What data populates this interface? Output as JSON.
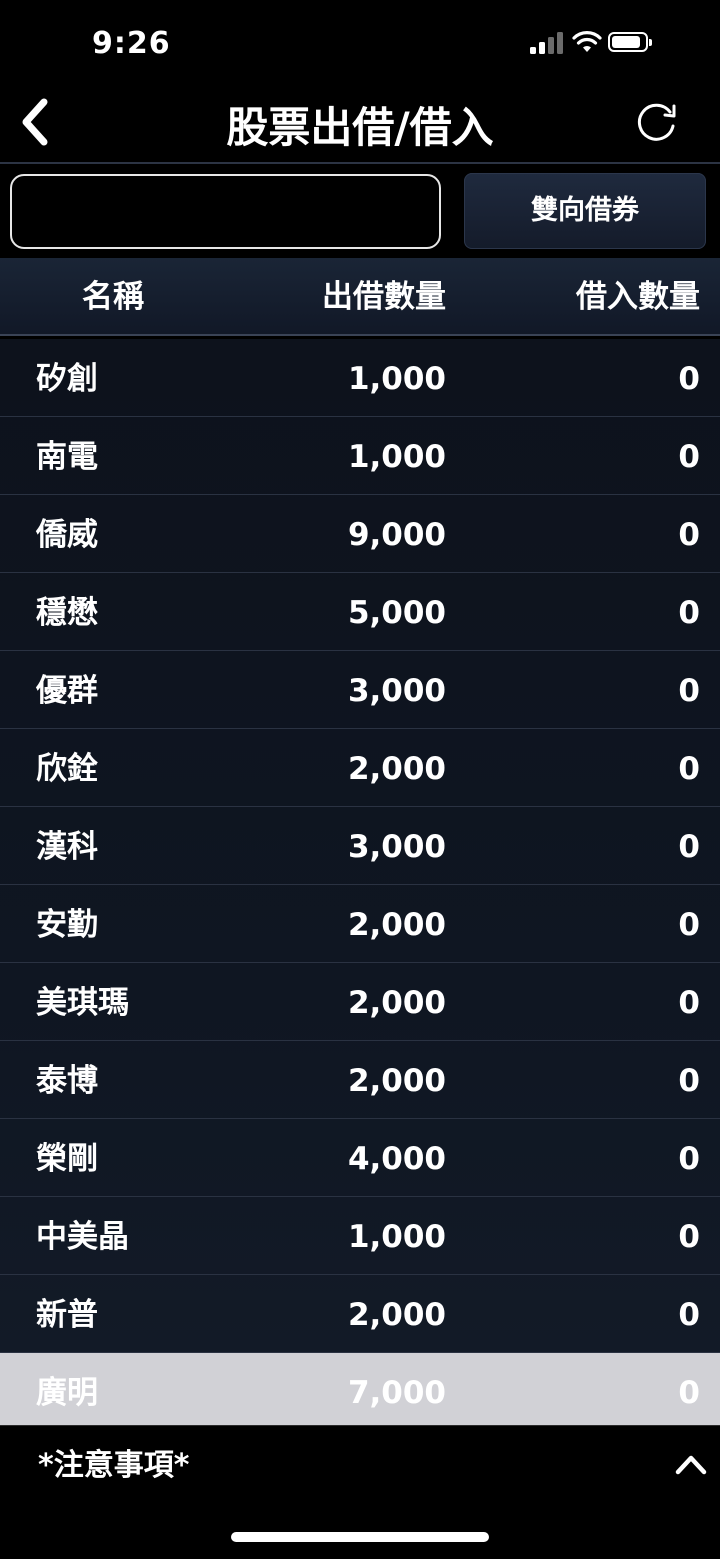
{
  "status": {
    "time": "9:26"
  },
  "nav": {
    "title": "股票出借/借入"
  },
  "search": {
    "account_value": "",
    "dual_button": "雙向借券"
  },
  "table": {
    "headers": {
      "name": "名稱",
      "lend": "出借數量",
      "borrow": "借入數量"
    },
    "rows": [
      {
        "name": "矽創",
        "lend": "1,000",
        "borrow": "0"
      },
      {
        "name": "南電",
        "lend": "1,000",
        "borrow": "0"
      },
      {
        "name": "僑威",
        "lend": "9,000",
        "borrow": "0"
      },
      {
        "name": "穩懋",
        "lend": "5,000",
        "borrow": "0"
      },
      {
        "name": "優群",
        "lend": "3,000",
        "borrow": "0"
      },
      {
        "name": "欣銓",
        "lend": "2,000",
        "borrow": "0"
      },
      {
        "name": "漢科",
        "lend": "3,000",
        "borrow": "0"
      },
      {
        "name": "安勤",
        "lend": "2,000",
        "borrow": "0"
      },
      {
        "name": "美琪瑪",
        "lend": "2,000",
        "borrow": "0"
      },
      {
        "name": "泰博",
        "lend": "2,000",
        "borrow": "0"
      },
      {
        "name": "榮剛",
        "lend": "4,000",
        "borrow": "0"
      },
      {
        "name": "中美晶",
        "lend": "1,000",
        "borrow": "0"
      },
      {
        "name": "新普",
        "lend": "2,000",
        "borrow": "0"
      },
      {
        "name": "廣明",
        "lend": "7,000",
        "borrow": "0"
      }
    ]
  },
  "notice": {
    "label": "*注意事項*"
  },
  "icons": {
    "back": "chevron-left-icon",
    "refresh": "refresh-icon",
    "expand": "chevron-up-icon"
  },
  "colors": {
    "highlight_row": "#d1d1d6",
    "background": "#000000"
  }
}
